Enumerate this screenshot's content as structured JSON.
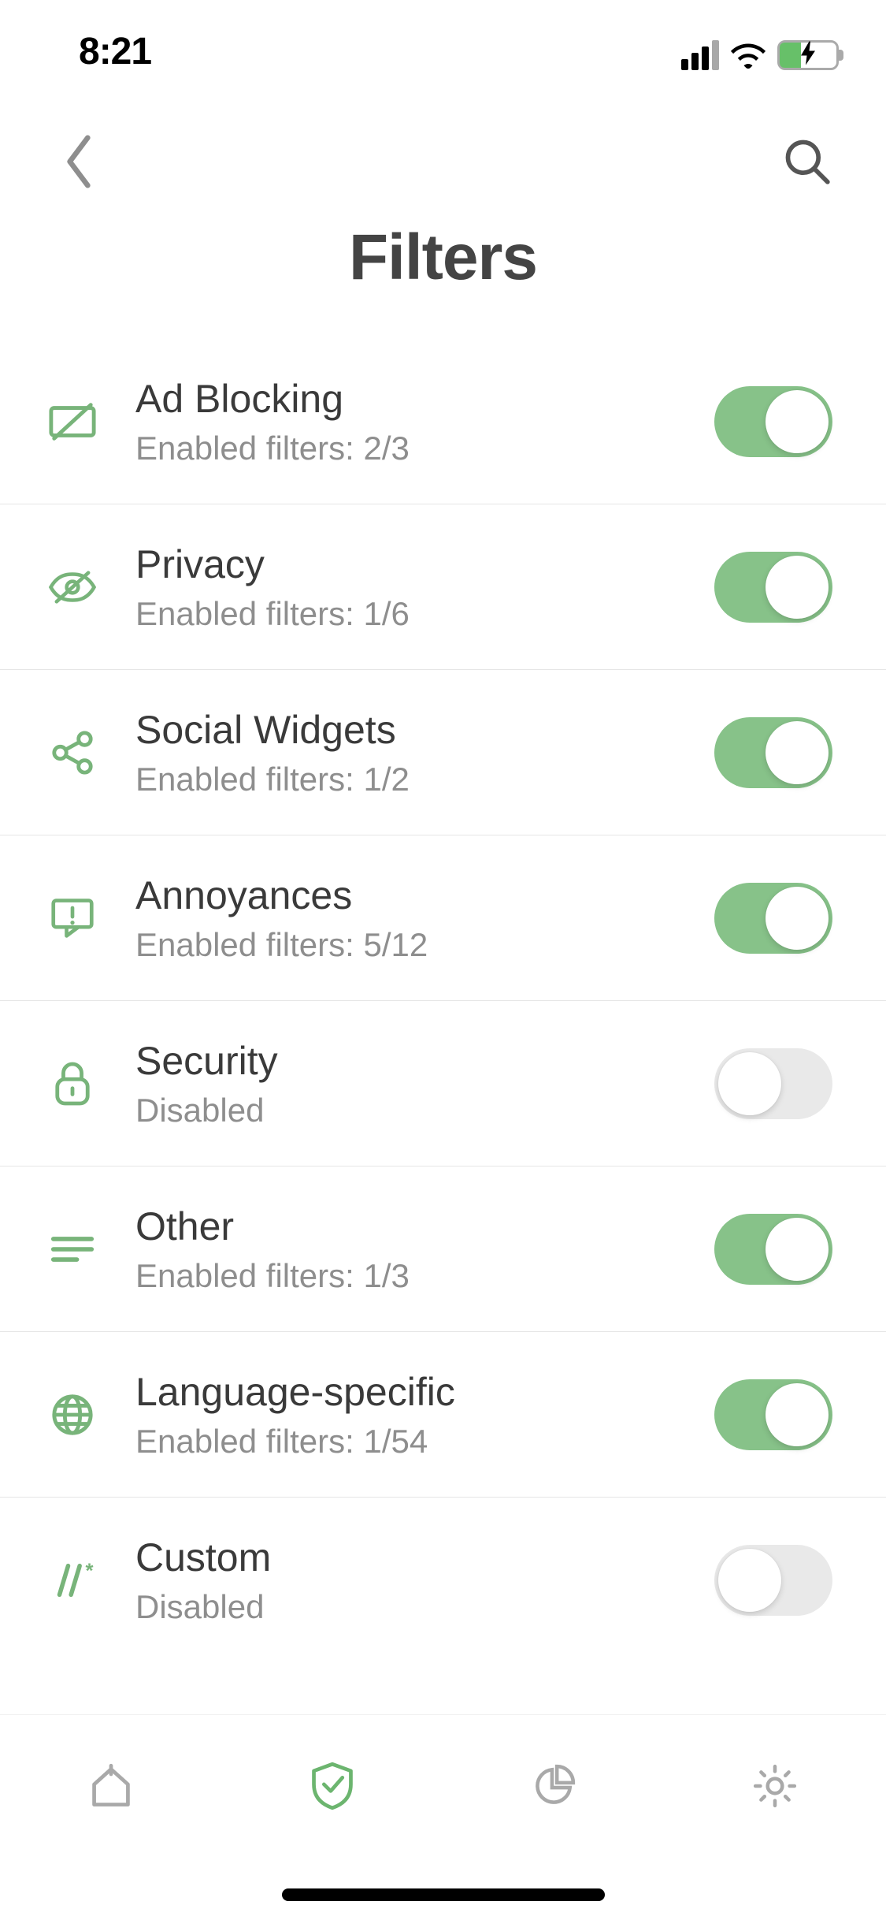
{
  "status": {
    "time": "8:21"
  },
  "header": {
    "title": "Filters"
  },
  "filters": [
    {
      "icon": "ad-block-icon",
      "title": "Ad Blocking",
      "subtitle": "Enabled filters: 2/3",
      "enabled": true
    },
    {
      "icon": "privacy-icon",
      "title": "Privacy",
      "subtitle": "Enabled filters: 1/6",
      "enabled": true
    },
    {
      "icon": "social-icon",
      "title": "Social Widgets",
      "subtitle": "Enabled filters: 1/2",
      "enabled": true
    },
    {
      "icon": "annoyance-icon",
      "title": "Annoyances",
      "subtitle": "Enabled filters: 5/12",
      "enabled": true
    },
    {
      "icon": "security-icon",
      "title": "Security",
      "subtitle": "Disabled",
      "enabled": false
    },
    {
      "icon": "other-icon",
      "title": "Other",
      "subtitle": "Enabled filters: 1/3",
      "enabled": true
    },
    {
      "icon": "language-icon",
      "title": "Language-specific",
      "subtitle": "Enabled filters: 1/54",
      "enabled": true
    },
    {
      "icon": "custom-icon",
      "title": "Custom",
      "subtitle": "Disabled",
      "enabled": false
    }
  ],
  "colors": {
    "accent": "#78b47a",
    "toggleOn": "#87c289",
    "textPrimary": "#3a3a3a",
    "textSecondary": "#8e8e8e"
  }
}
